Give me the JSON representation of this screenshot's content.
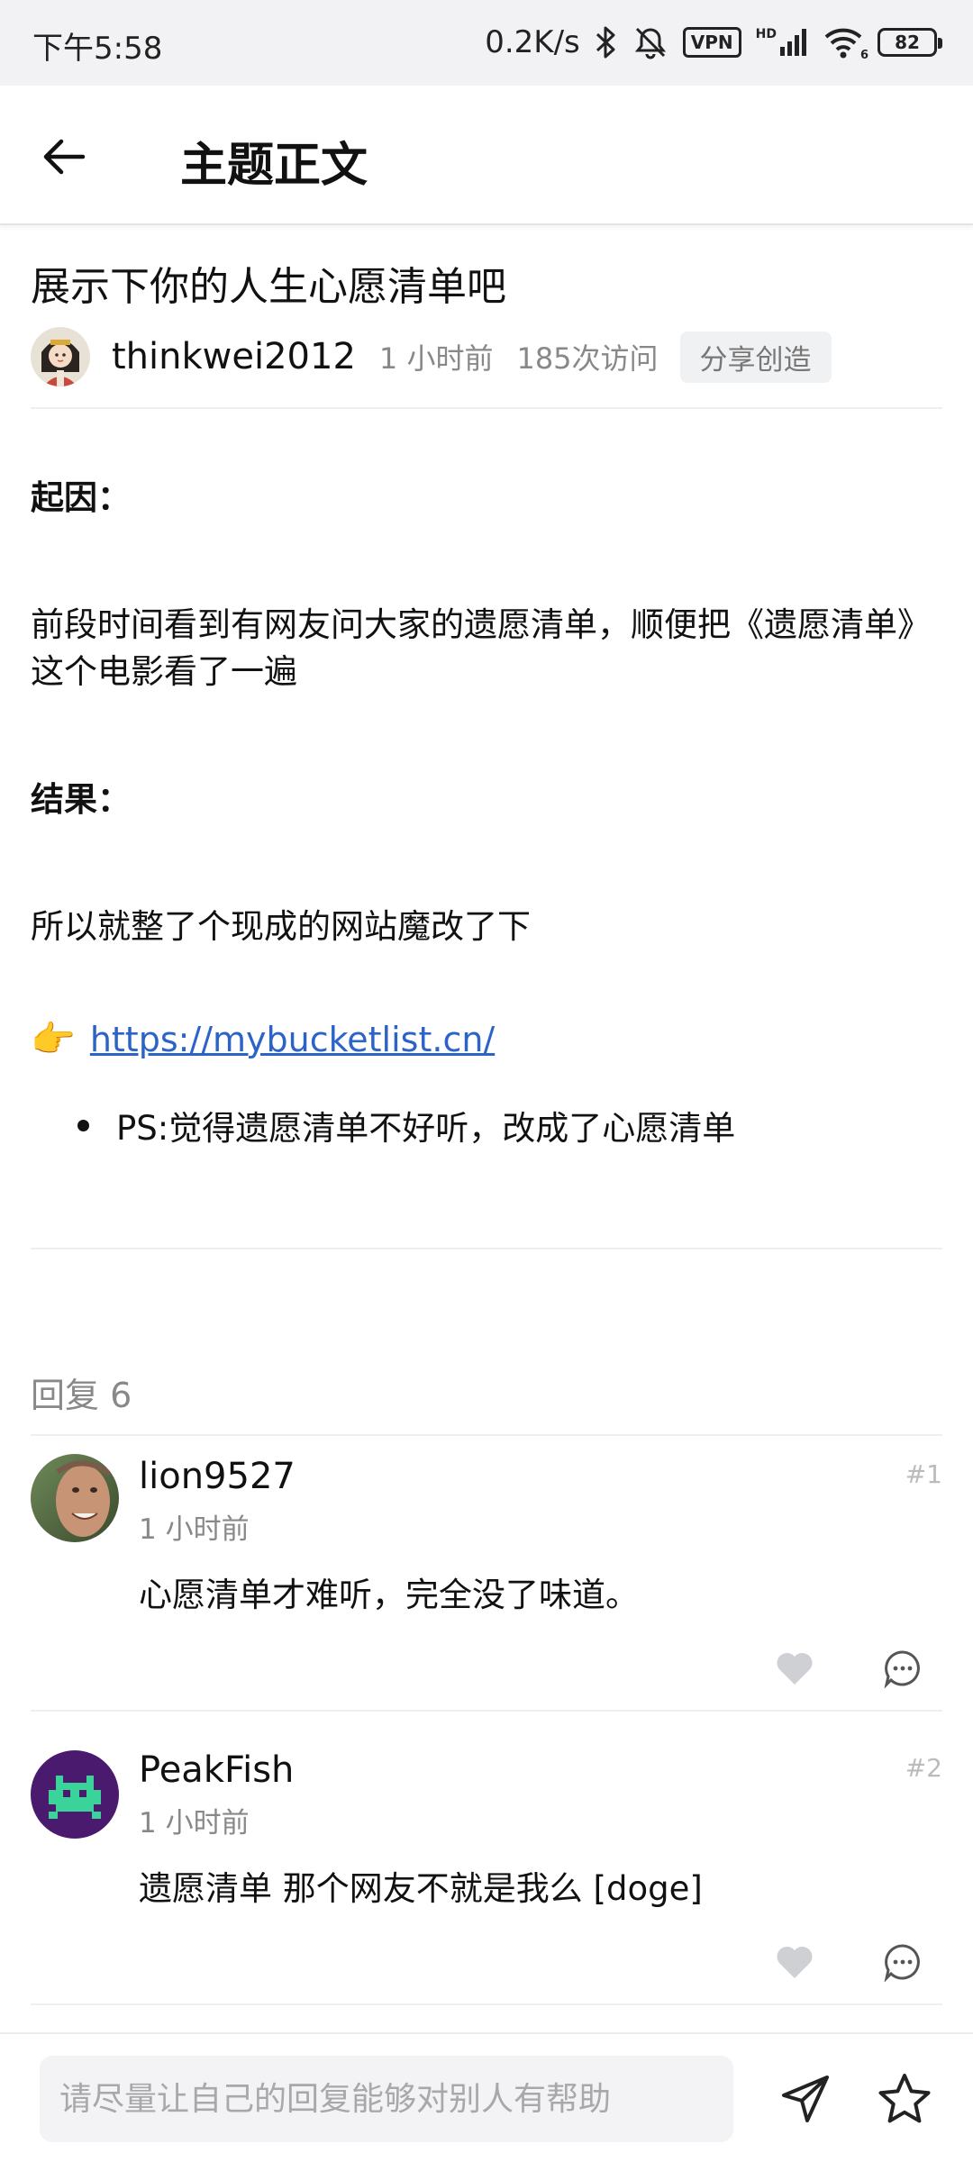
{
  "status_bar": {
    "time": "下午5:58",
    "net_speed": "0.2K/s",
    "vpn_label": "VPN",
    "signal_label": "HD",
    "wifi_label": "6",
    "battery": "82",
    "icons": [
      "bluetooth-icon",
      "mute-icon",
      "vpn-icon",
      "signal-icon",
      "wifi-icon",
      "battery-icon"
    ]
  },
  "app_bar": {
    "title": "主题正文",
    "back_icon": "arrow-left-icon"
  },
  "post": {
    "title": "展示下你的人生心愿清单吧",
    "author": "thinkwei2012",
    "time": "1 小时前",
    "views": "185次访问",
    "tag": "分享创造",
    "body": {
      "heading1": "起因：",
      "para1": "前段时间看到有网友问大家的遗愿清单，顺便把《遗愿清单》这个电影看了一遍",
      "heading2": "结果：",
      "para2": "所以就整了个现成的网站魔改了下",
      "link_emoji": "👉",
      "link": "https://mybucketlist.cn/",
      "bullet": "PS:觉得遗愿清单不好听，改成了心愿清单"
    }
  },
  "replies": {
    "count_label": "回复 6",
    "items": [
      {
        "user": "lion9527",
        "time": "1 小时前",
        "floor": "#1",
        "content": "心愿清单才难听，完全没了味道。"
      },
      {
        "user": "PeakFish",
        "time": "1 小时前",
        "floor": "#2",
        "content": "遗愿清单 那个网友不就是我么 [doge]"
      }
    ]
  },
  "bottom_bar": {
    "input_placeholder": "请尽量让自己的回复能够对别人有帮助",
    "send_icon": "send-icon",
    "favorite_icon": "star-icon"
  },
  "colors": {
    "link": "#2b63c8",
    "muted_text": "#888888",
    "icon_gray": "#cfd0d4",
    "status_bar_bg": "#f2f2f4"
  }
}
